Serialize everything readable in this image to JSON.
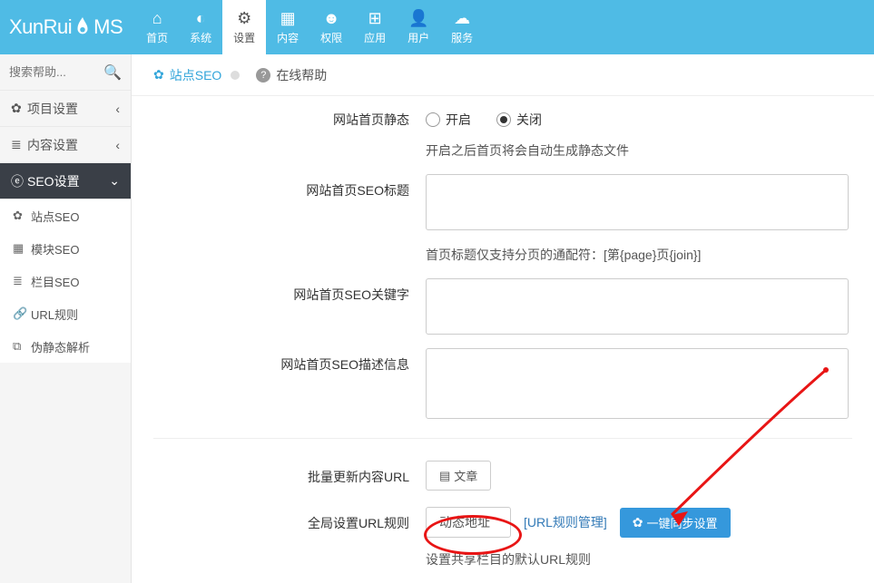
{
  "brand": {
    "part1": "XunRui",
    "part2": "MS"
  },
  "nav": [
    {
      "id": "home",
      "label": "首页",
      "glyph": "⌂"
    },
    {
      "id": "system",
      "label": "系统",
      "glyph": "◐"
    },
    {
      "id": "setting",
      "label": "设置",
      "glyph": "⚙"
    },
    {
      "id": "content",
      "label": "内容",
      "glyph": "▦"
    },
    {
      "id": "auth",
      "label": "权限",
      "glyph": "☻"
    },
    {
      "id": "app",
      "label": "应用",
      "glyph": "⊞"
    },
    {
      "id": "user",
      "label": "用户",
      "glyph": "👤"
    },
    {
      "id": "service",
      "label": "服务",
      "glyph": "☁"
    }
  ],
  "nav_active": "setting",
  "sidebar": {
    "search_placeholder": "搜索帮助...",
    "groups": [
      {
        "id": "project",
        "label": "项目设置",
        "glyph": "✿",
        "open": false
      },
      {
        "id": "content",
        "label": "内容设置",
        "glyph": "≣",
        "open": false
      },
      {
        "id": "seo",
        "label": "SEO设置",
        "glyph": "ⓔ",
        "open": true,
        "items": [
          {
            "id": "site-seo",
            "label": "站点SEO",
            "glyph": "✿"
          },
          {
            "id": "module-seo",
            "label": "模块SEO",
            "glyph": "▦"
          },
          {
            "id": "column-seo",
            "label": "栏目SEO",
            "glyph": "≣"
          },
          {
            "id": "url-rule",
            "label": "URL规则",
            "glyph": "🔗"
          },
          {
            "id": "rewrite",
            "label": "伪静态解析",
            "glyph": "⧉"
          }
        ]
      }
    ]
  },
  "tabs": {
    "active": "站点SEO",
    "help": "在线帮助"
  },
  "form": {
    "static_label": "网站首页静态",
    "static_on": "开启",
    "static_off": "关闭",
    "static_checked": "off",
    "static_help": "开启之后首页将会自动生成静态文件",
    "seo_title_label": "网站首页SEO标题",
    "seo_title_value": "",
    "seo_title_help": "首页标题仅支持分页的通配符：[第{page}页{join}]",
    "seo_keywords_label": "网站首页SEO关键字",
    "seo_keywords_value": "",
    "seo_desc_label": "网站首页SEO描述信息",
    "seo_desc_value": "",
    "batch_url_label": "批量更新内容URL",
    "batch_url_btn": "文章",
    "global_url_label": "全局设置URL规则",
    "global_url_select": "动态地址",
    "global_url_link": "[URL规则管理]",
    "global_url_sync_btn": "一键同步设置",
    "global_url_help": "设置共享栏目的默认URL规则"
  }
}
